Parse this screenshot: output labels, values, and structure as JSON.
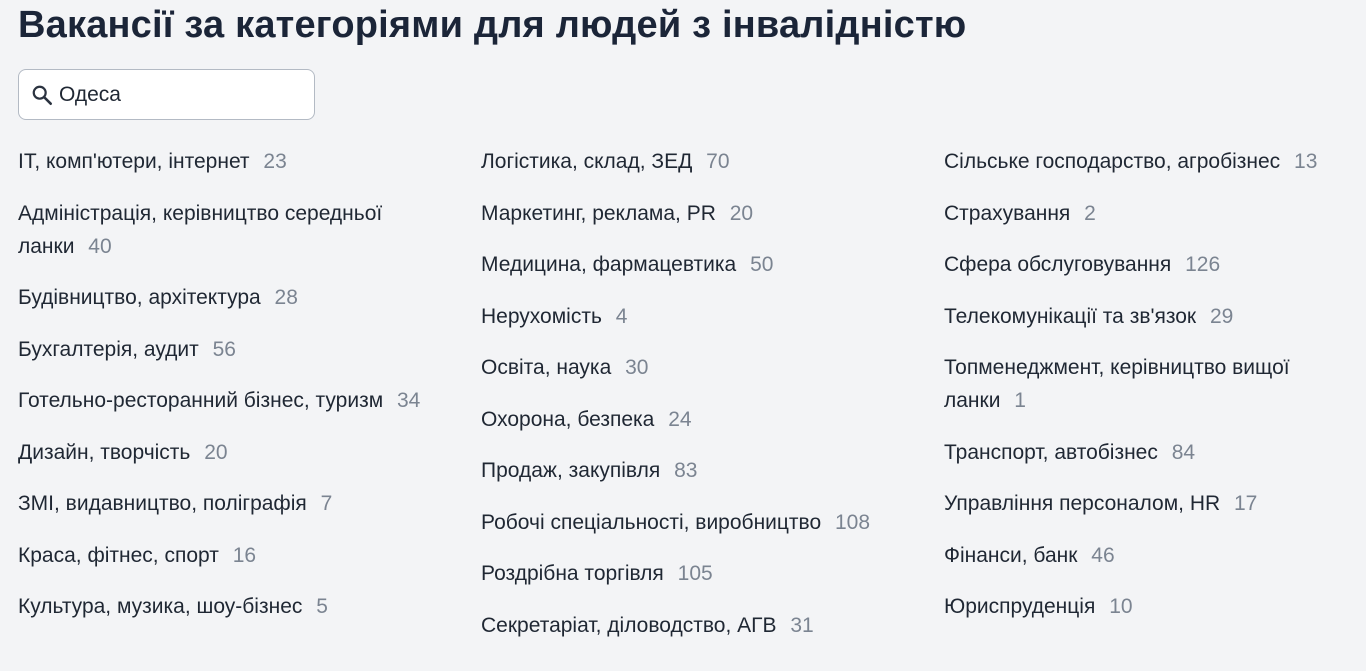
{
  "title": "Вакансії за категоріями для людей з інвалідністю",
  "search": {
    "value": "Одеса",
    "icon": "search-icon"
  },
  "columns": [
    [
      {
        "name": "IT, комп'ютери, інтернет",
        "count": "23"
      },
      {
        "name": "Адміністрація, керівництво середньої ланки",
        "count": "40"
      },
      {
        "name": "Будівництво, архітектура",
        "count": "28"
      },
      {
        "name": "Бухгалтерія, аудит",
        "count": "56"
      },
      {
        "name": "Готельно-ресторанний бізнес, туризм",
        "count": "34"
      },
      {
        "name": "Дизайн, творчість",
        "count": "20"
      },
      {
        "name": "ЗМІ, видавництво, поліграфія",
        "count": "7"
      },
      {
        "name": "Краса, фітнес, спорт",
        "count": "16"
      },
      {
        "name": "Культура, музика, шоу-бізнес",
        "count": "5"
      }
    ],
    [
      {
        "name": "Логістика, склад, ЗЕД",
        "count": "70"
      },
      {
        "name": "Маркетинг, реклама, PR",
        "count": "20"
      },
      {
        "name": "Медицина, фармацевтика",
        "count": "50"
      },
      {
        "name": "Нерухомість",
        "count": "4"
      },
      {
        "name": "Освіта, наука",
        "count": "30"
      },
      {
        "name": "Охорона, безпека",
        "count": "24"
      },
      {
        "name": "Продаж, закупівля",
        "count": "83"
      },
      {
        "name": "Робочі спеціальності, виробництво",
        "count": "108"
      },
      {
        "name": "Роздрібна торгівля",
        "count": "105"
      },
      {
        "name": "Секретаріат, діловодство, АГВ",
        "count": "31"
      }
    ],
    [
      {
        "name": "Сільське господарство, агробізнес",
        "count": "13"
      },
      {
        "name": "Страхування",
        "count": "2"
      },
      {
        "name": "Сфера обслуговування",
        "count": "126"
      },
      {
        "name": "Телекомунікації та зв'язок",
        "count": "29"
      },
      {
        "name": "Топменеджмент, керівництво вищої ланки",
        "count": "1"
      },
      {
        "name": "Транспорт, автобізнес",
        "count": "84"
      },
      {
        "name": "Управління персоналом, HR",
        "count": "17"
      },
      {
        "name": "Фінанси, банк",
        "count": "46"
      },
      {
        "name": "Юриспруденція",
        "count": "10"
      }
    ]
  ]
}
